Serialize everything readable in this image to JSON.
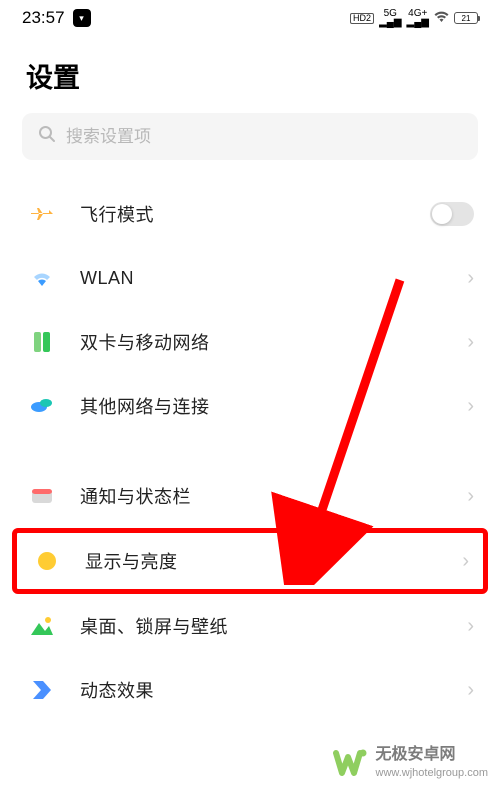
{
  "status": {
    "time": "23:57",
    "hd_badge": "HD2",
    "sig1": "5G",
    "sig2": "4G+",
    "battery_pct": "21"
  },
  "page_title": "设置",
  "search": {
    "placeholder": "搜索设置项"
  },
  "rows": {
    "airplane": "飞行模式",
    "wlan": "WLAN",
    "sim": "双卡与移动网络",
    "other_net": "其他网络与连接",
    "notif": "通知与状态栏",
    "display": "显示与亮度",
    "home": "桌面、锁屏与壁纸",
    "motion": "动态效果"
  },
  "watermark": {
    "title": "无极安卓网",
    "url": "www.wjhotelgroup.com"
  }
}
